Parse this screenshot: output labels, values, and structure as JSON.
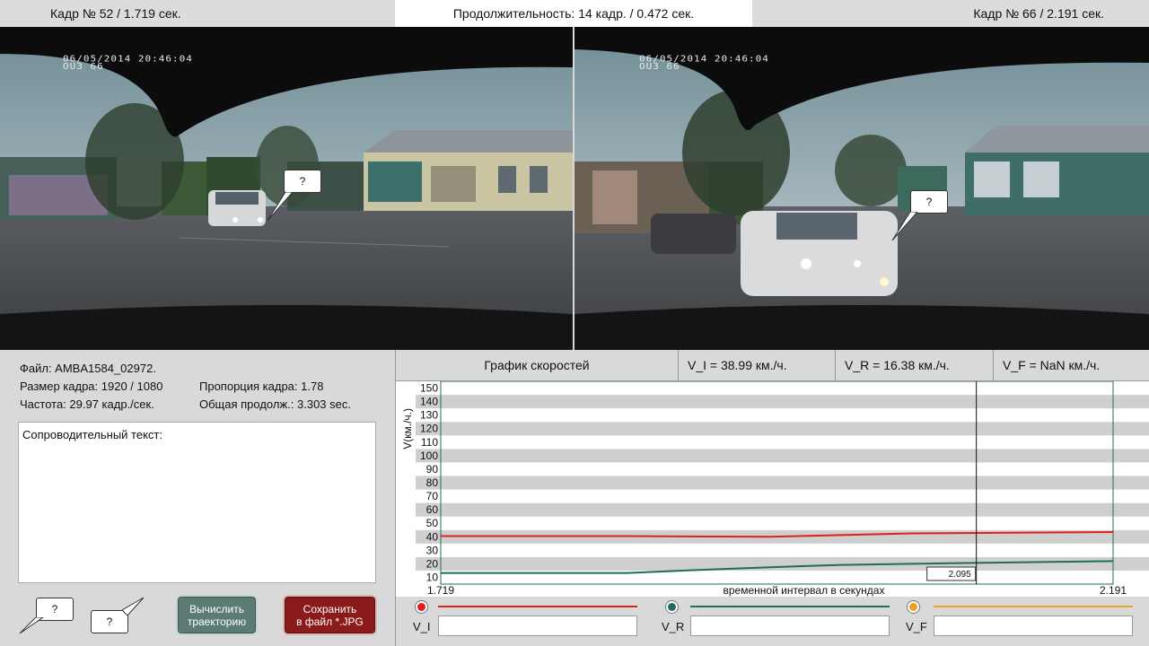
{
  "top": {
    "left_frame_label": "Кадр № 52 / 1.719 сек.",
    "duration_label": "Продолжительность: 14 кадр. / 0.472 сек.",
    "right_frame_label": "Кадр № 66 / 2.191 сек."
  },
  "frames": {
    "left_stamp_line1": "06/05/2014 20:46:04",
    "left_stamp_line2": "OU3 66",
    "right_stamp_line1": "06/05/2014 20:46:04",
    "right_stamp_line2": "OU3 66",
    "left_marker": "?",
    "right_marker": "?"
  },
  "file_info": {
    "file": "Файл: AMBA1584_02972.",
    "frame_size": "Размер кадра: 1920 / 1080",
    "aspect": "Пропорция кадра: 1.78",
    "fps": "Частота: 29.97 кадр./сек.",
    "total": "Общая продолж.: 3.303 sec."
  },
  "notes_label": "Сопроводительный текст:",
  "tools": {
    "marker_a": "?",
    "marker_b": "?"
  },
  "buttons": {
    "calc_line1": "Вычислить",
    "calc_line2": "траекторию",
    "save_line1": "Сохранить",
    "save_line2": "в файл *.JPG"
  },
  "header": {
    "title": "График скоростей",
    "vi": "V_I =  38.99 км./ч.",
    "vr": "V_R =  16.38 км./ч.",
    "vf": "V_F =  NaN км./ч."
  },
  "chart_data": {
    "type": "line",
    "ylabel": "V(км./ч.)",
    "xlabel": "временной интервал в секундах",
    "xlim": [
      1.719,
      2.191
    ],
    "x_start_label": "1.719",
    "x_end_label": "2.191",
    "ylim": [
      5,
      155
    ],
    "yticks": [
      150,
      140,
      130,
      120,
      110,
      100,
      90,
      80,
      70,
      60,
      50,
      40,
      30,
      20,
      10
    ],
    "cursor_x": 2.095,
    "cursor_label": "2.095",
    "series": [
      {
        "name": "V_I",
        "color": "#e02020",
        "x": [
          1.719,
          1.85,
          1.95,
          2.05,
          2.191
        ],
        "y": [
          40.5,
          40.5,
          40.0,
          42.5,
          43.5
        ]
      },
      {
        "name": "V_R",
        "color": "#1f6b5e",
        "x": [
          1.719,
          1.85,
          1.9,
          1.95,
          2.0,
          2.1,
          2.191
        ],
        "y": [
          13.2,
          13.2,
          15.5,
          17.5,
          19.2,
          20.8,
          22.0
        ]
      }
    ]
  },
  "legend": {
    "vi_label": "V_I",
    "vi_color": "#e02020",
    "vr_label": "V_R",
    "vr_color": "#1f6b5e",
    "vf_label": "V_F",
    "vf_color": "#f0a020"
  }
}
